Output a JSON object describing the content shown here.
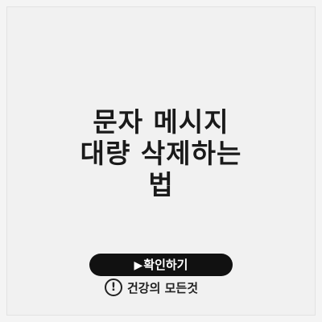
{
  "article": {
    "title_lines": [
      "문자 메시지",
      "대량 삭제하는",
      "법"
    ]
  },
  "cta": {
    "arrow": "▶",
    "label": "확인하기"
  },
  "brand": {
    "icon_glyph": "!",
    "name": "건강의 모든것"
  },
  "colors": {
    "background": "#f1f1f1",
    "button": "#111111",
    "button_text": "#ffffff",
    "text": "#1a1a1a"
  }
}
